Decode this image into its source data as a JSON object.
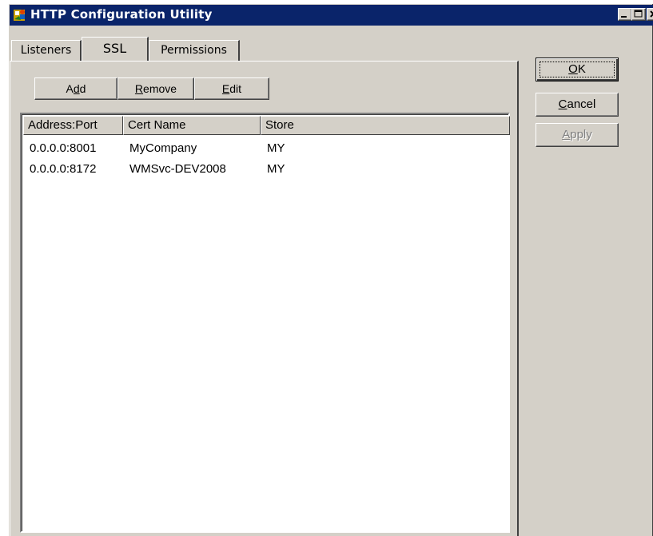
{
  "window": {
    "title": "HTTP Configuration Utility"
  },
  "tabs": [
    {
      "label": "Listeners",
      "active": false
    },
    {
      "label": "SSL",
      "active": true
    },
    {
      "label": "Permissions",
      "active": false
    }
  ],
  "toolbar": {
    "add": {
      "pre": "A",
      "mn": "d",
      "post": "d"
    },
    "remove": {
      "pre": "",
      "mn": "R",
      "post": "emove"
    },
    "edit": {
      "pre": "",
      "mn": "E",
      "post": "dit"
    }
  },
  "list": {
    "columns": [
      "Address:Port",
      "Cert Name",
      "Store"
    ],
    "rows": [
      [
        "0.0.0.0:8001",
        "MyCompany",
        "MY"
      ],
      [
        "0.0.0.0:8172",
        "WMSvc-DEV2008",
        "MY"
      ]
    ]
  },
  "dialog_buttons": {
    "ok": {
      "pre": "",
      "mn": "O",
      "post": "K"
    },
    "cancel": {
      "pre": "",
      "mn": "C",
      "post": "ancel"
    },
    "apply": {
      "pre": "",
      "mn": "A",
      "post": "pply",
      "disabled": true
    }
  },
  "icons": {
    "app": "app-icon",
    "minimize": "minimize-icon",
    "maximize": "maximize-icon",
    "close": "close-icon"
  }
}
